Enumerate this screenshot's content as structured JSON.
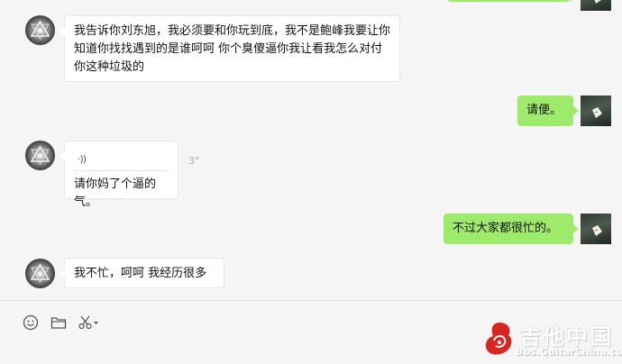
{
  "messages": [
    {
      "side": "left",
      "text": "我告诉你刘东旭，我必须要和你玩到底，我不是鲍峰我要让你知道你找找遇到的是谁呵呵 你个臭傻逼你我让看我怎么对付你这种垃圾的"
    },
    {
      "side": "right",
      "text": "请便。"
    },
    {
      "side": "left",
      "type": "voice",
      "duration": "3\"",
      "transcript": "请你妈了个逼的气。"
    },
    {
      "side": "right",
      "text": "不过大家都很忙的。"
    },
    {
      "side": "left",
      "text": "我不忙，呵呵 我经历很多"
    }
  ],
  "toolbar": {
    "icons": [
      "emoji-icon",
      "folder-icon",
      "scissors-icon"
    ]
  },
  "watermark": {
    "title": "吉他中国",
    "subtitle": "Bbs.GuitarChina.com"
  },
  "colors": {
    "sent_bubble": "#9eea6a",
    "received_bubble": "#ffffff",
    "background": "#f5f5f5"
  }
}
